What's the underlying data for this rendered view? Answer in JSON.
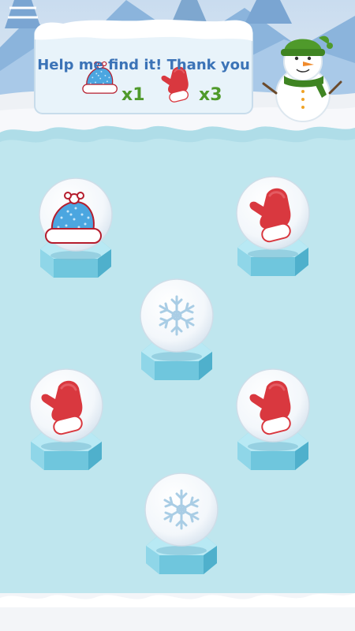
{
  "task_banner": {
    "title": "Help me find it! Thank you",
    "requests": [
      {
        "item": "hat-icon",
        "count_label": "x1"
      },
      {
        "item": "mitten-icon",
        "count_label": "x3"
      }
    ]
  },
  "board": {
    "slots": [
      {
        "id": "top-left",
        "state": "revealed",
        "item": "hat-icon"
      },
      {
        "id": "top-right",
        "state": "revealed",
        "item": "mitten-icon"
      },
      {
        "id": "middle-center",
        "state": "hidden",
        "item": "snowflake-icon"
      },
      {
        "id": "lower-left",
        "state": "revealed",
        "item": "mitten-icon"
      },
      {
        "id": "lower-right",
        "state": "revealed",
        "item": "mitten-icon"
      },
      {
        "id": "bottom-center",
        "state": "hidden",
        "item": "snowflake-icon"
      }
    ]
  },
  "colors": {
    "banner_text": "#3b73b7",
    "count_text": "#4f9a2b",
    "ice": "#b9e4ee",
    "mitten": "#d9383f",
    "hat": "#4ba6e0"
  }
}
